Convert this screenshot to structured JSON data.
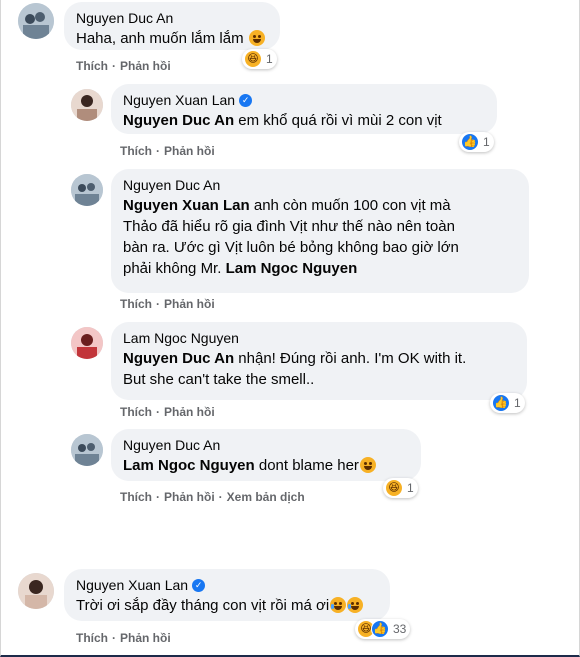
{
  "comments": [
    {
      "author": "Nguyen Duc An",
      "verified": false,
      "mention": "",
      "text": "Haha, anh muốn lắm lắm",
      "actions": [
        "Thích",
        "Phản hồi"
      ],
      "reaction_count": "1",
      "reaction_types": [
        "haha-icon"
      ],
      "avatar": "group-photo-avatar"
    },
    {
      "author": "Nguyen Xuan Lan",
      "verified": true,
      "mention": "Nguyen Duc An",
      "text": " em khổ quá rồi vì mùi 2 con vịt",
      "actions": [
        "Thích",
        "Phản hồi"
      ],
      "reaction_count": "1",
      "reaction_types": [
        "like-icon"
      ],
      "avatar": "woman-photo-avatar"
    },
    {
      "author": "Nguyen Duc An",
      "verified": false,
      "mention": "Nguyen Xuan Lan",
      "text_line1": " anh còn muốn 100 con vịt mà",
      "text_line2": "Thảo đã hiểu rõ gia đình Vịt như thế nào nên toàn",
      "text_line3": "bàn ra. Ước gì Vịt luôn bé bỏng không bao giờ lớn",
      "text_line4_prefix": "phải không Mr. ",
      "mention2": "Lam Ngoc Nguyen",
      "actions": [
        "Thích",
        "Phản hồi"
      ],
      "avatar": "group-photo-avatar"
    },
    {
      "author": "Lam Ngoc Nguyen",
      "verified": false,
      "mention": "Nguyen Duc An",
      "text_line1": " nhận! Đúng rồi anh. I'm OK with it.",
      "text_line2": "But she can't take the smell..",
      "actions": [
        "Thích",
        "Phản hồi"
      ],
      "reaction_count": "1",
      "reaction_types": [
        "like-icon"
      ],
      "avatar": "woman-red-avatar"
    },
    {
      "author": "Nguyen Duc An",
      "verified": false,
      "mention": "Lam Ngoc Nguyen",
      "text": " dont blame her",
      "actions": [
        "Thích",
        "Phản hồi",
        "Xem bản dịch"
      ],
      "reaction_count": "1",
      "reaction_types": [
        "haha-icon"
      ],
      "avatar": "group-photo-avatar"
    },
    {
      "author": "Nguyen Xuan Lan",
      "verified": true,
      "mention": "",
      "text": "Trời ơi sắp đầy tháng con vịt rồi má ơi",
      "actions": [
        "Thích",
        "Phản hồi"
      ],
      "reaction_count": "33",
      "reaction_types": [
        "haha-icon",
        "like-icon"
      ],
      "avatar": "woman-photo-avatar"
    }
  ],
  "colors": {
    "bubble": "#f0f2f5",
    "link_blue": "#1877f2",
    "meta_gray": "#65676b",
    "haha_yellow": "#f7b125"
  }
}
